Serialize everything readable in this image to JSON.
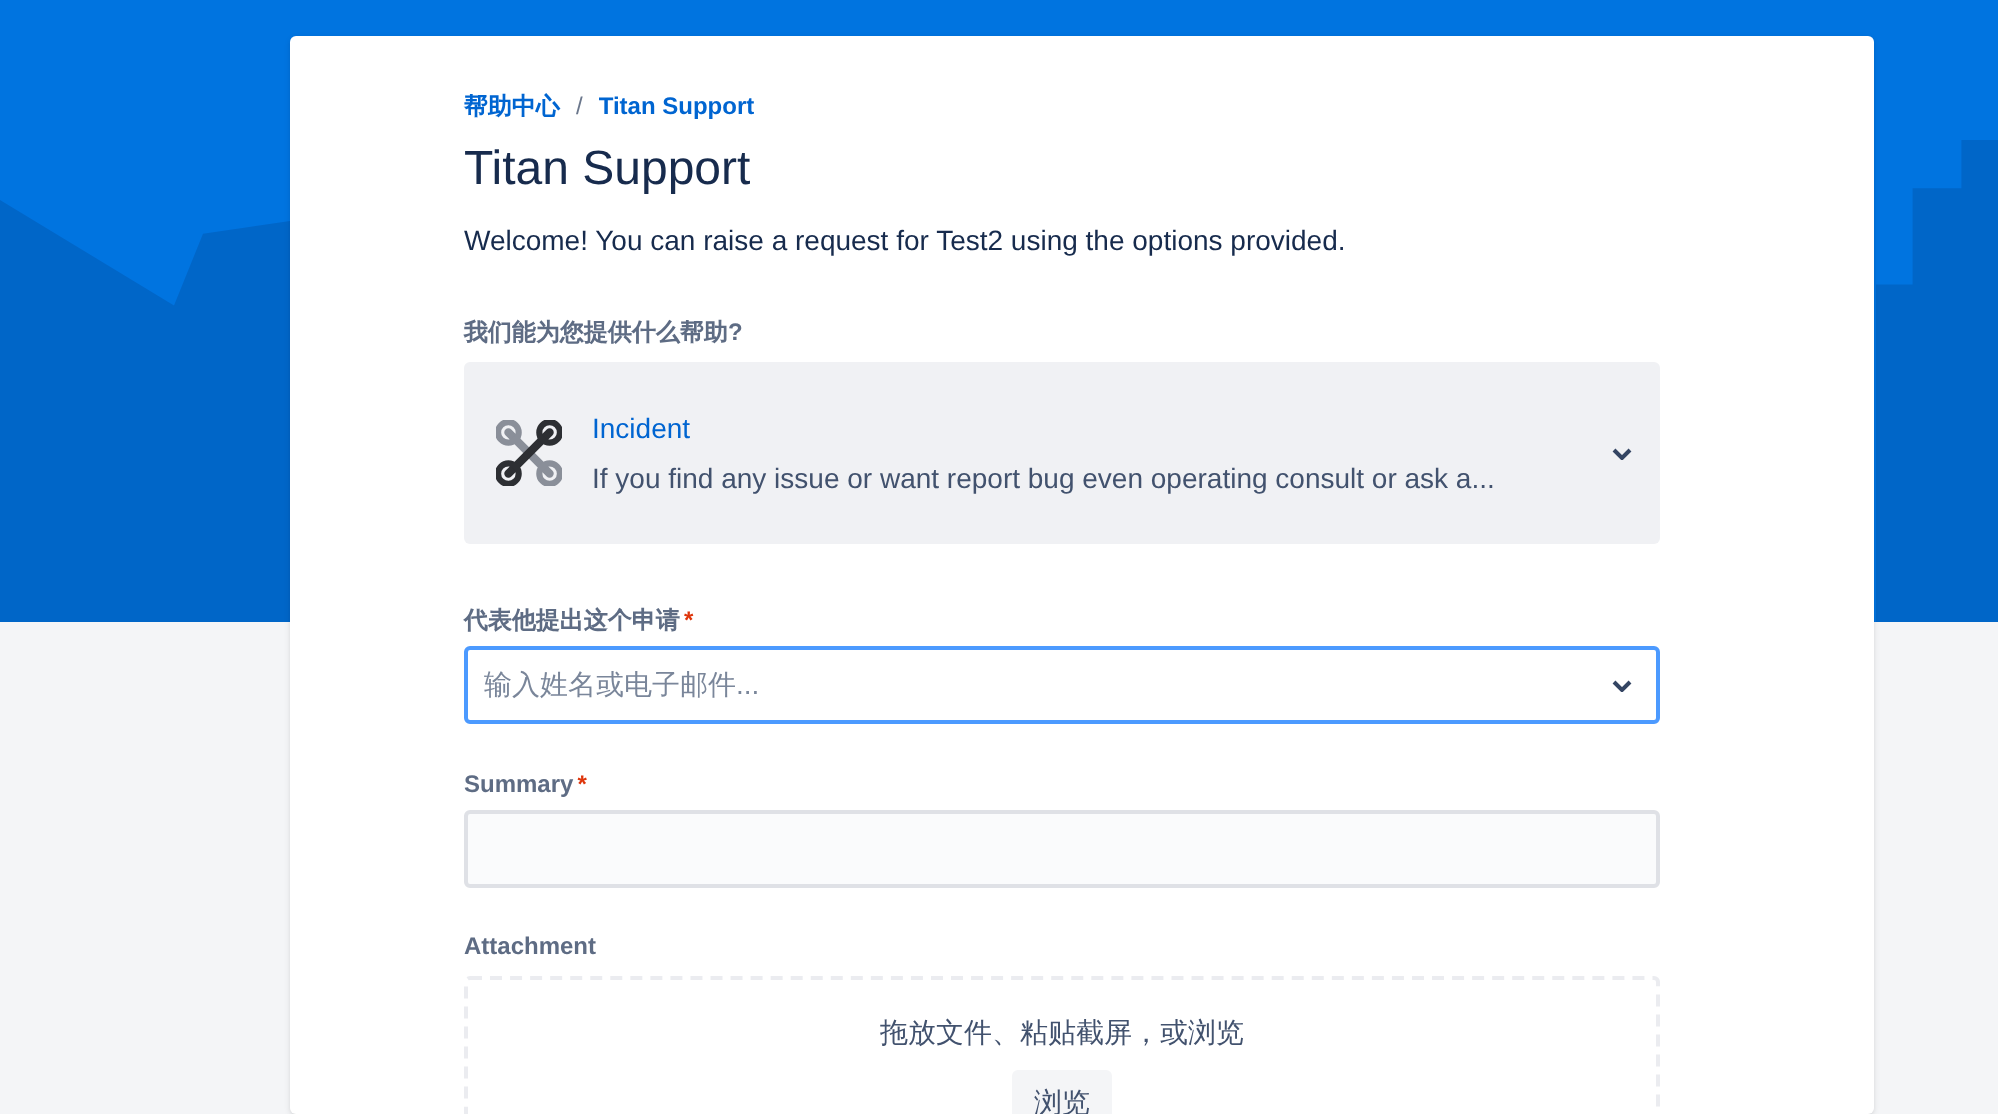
{
  "breadcrumb": [
    "帮助中心",
    "/",
    "Titan Support"
  ],
  "title": "Titan Support",
  "welcome": "Welcome! You can raise a request for Test2 using the options provided.",
  "request_type": {
    "label": "我们能为您提供什么帮助?",
    "name": "Incident",
    "description": "If you find any issue or want report bug even operating consult or ask a..."
  },
  "fields": [
    {
      "kind": "select",
      "label": "代表他提出这个申请",
      "required_mark": "*",
      "placeholder": "输入姓名或电子邮件...",
      "focused": true
    },
    {
      "kind": "text",
      "label": "Summary",
      "required_mark": "*",
      "focused": false
    },
    {
      "kind": "attachment",
      "label": "Attachment",
      "hint": "拖放文件、粘贴截屏，或浏览",
      "button": "浏览"
    }
  ]
}
